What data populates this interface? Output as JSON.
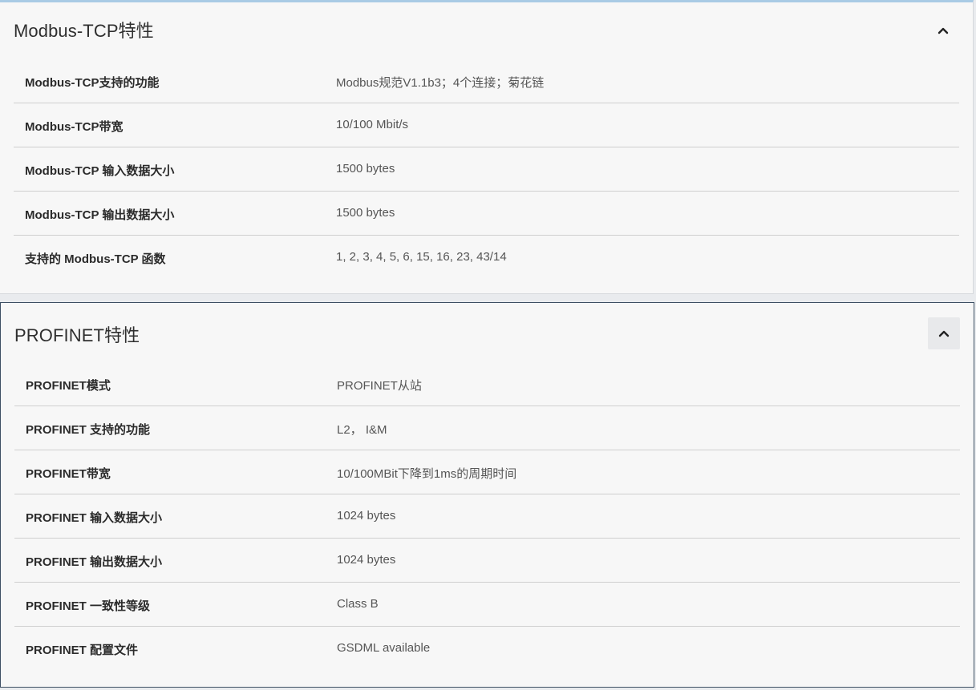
{
  "sections": [
    {
      "title": "Modbus-TCP特性",
      "toggle_icon": "chevron-up-icon",
      "rows": [
        {
          "label": "Modbus-TCP支持的功能",
          "value": "Modbus规范V1.1b3；4个连接；菊花链"
        },
        {
          "label": "Modbus-TCP带宽",
          "value": "10/100 Mbit/s"
        },
        {
          "label": "Modbus-TCP 输入数据大小",
          "value": "1500 bytes"
        },
        {
          "label": "Modbus-TCP 输出数据大小",
          "value": "1500 bytes"
        },
        {
          "label": "支持的 Modbus-TCP 函数",
          "value": "1, 2, 3, 4, 5, 6, 15, 16, 23, 43/14"
        }
      ]
    },
    {
      "title": "PROFINET特性",
      "toggle_icon": "chevron-up-icon",
      "rows": [
        {
          "label": "PROFINET模式",
          "value": "PROFINET从站"
        },
        {
          "label": "PROFINET 支持的功能",
          "value": "L2， I&M"
        },
        {
          "label": "PROFINET带宽",
          "value": "10/100MBit下降到1ms的周期时间"
        },
        {
          "label": "PROFINET 输入数据大小",
          "value": "1024 bytes"
        },
        {
          "label": "PROFINET 输出数据大小",
          "value": "1024 bytes"
        },
        {
          "label": "PROFINET 一致性等级",
          "value": "Class B"
        },
        {
          "label": "PROFINET 配置文件",
          "value": "GSDML available"
        }
      ]
    }
  ],
  "colors": {
    "panel_bg": "#f7f7f7",
    "divider": "#cfcfcf",
    "top_accent": "#a9cbe5",
    "focus_border": "#3d4f63"
  }
}
